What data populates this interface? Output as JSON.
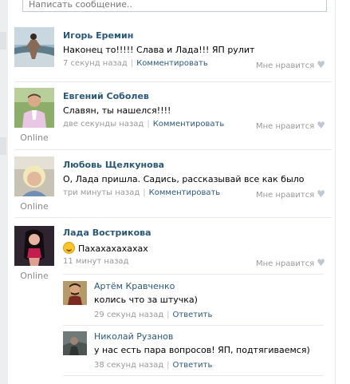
{
  "compose": {
    "placeholder": "Написать сообщение.."
  },
  "posts": [
    {
      "author": "Игорь Еремин",
      "text": "Наконец то!!!!! Слава и Лада!!! ЯП рулит",
      "time": "7 секунд назад",
      "comment_label": "Комментировать",
      "like_label": "Мне нравится",
      "online": ""
    },
    {
      "author": "Евгений Соболев",
      "text": "Славян, ты нашелся!!!!",
      "time": "две секунды назад",
      "comment_label": "Комментировать",
      "like_label": "Мне нравится",
      "online": "Online"
    },
    {
      "author": "Любовь Щелкунова",
      "text": "О, Лада пришла. Садись, рассказывай все как было",
      "time": "три минуты назад",
      "comment_label": "Комментировать",
      "like_label": "Мне нравится",
      "online": "Online"
    },
    {
      "author": "Лада Вострикова",
      "text": "Пахахахахахах",
      "time": "11 минут назад",
      "like_label": "Мне нравится",
      "online": "Online",
      "replies": [
        {
          "author": "Артём Кравченко",
          "text": "колись что за штучка)",
          "time": "29 секунд назад",
          "reply_label": "Ответить"
        },
        {
          "author": "Николай Рузанов",
          "text": "у нас есть пара вопросов! ЯП, подтягиваемся)",
          "time": "38 секунд назад",
          "reply_label": "Ответить"
        }
      ]
    }
  ],
  "colors": {
    "link": "#2b587a",
    "meta": "#999999",
    "divider": "#e6eaee",
    "heart": "#bcc8d4"
  },
  "icons": [
    "heart-icon",
    "laughing-smiley-icon"
  ]
}
